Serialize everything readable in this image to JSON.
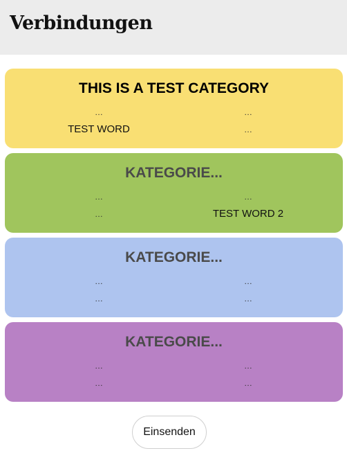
{
  "header": {
    "title": "Verbindungen"
  },
  "categories": [
    {
      "title": "THIS IS A TEST CATEGORY",
      "color": "#f9df73",
      "words": [
        [
          "…",
          "…"
        ],
        [
          "TEST WORD",
          "…"
        ]
      ]
    },
    {
      "title": "KATEGORIE...",
      "color": "#a0c55d",
      "words": [
        [
          "…",
          "…"
        ],
        [
          "…",
          "TEST WORD 2"
        ]
      ]
    },
    {
      "title": "KATEGORIE...",
      "color": "#aec4ef",
      "words": [
        [
          "…",
          "…"
        ],
        [
          "…",
          "…"
        ]
      ]
    },
    {
      "title": "KATEGORIE...",
      "color": "#b881c5",
      "words": [
        [
          "…",
          "…"
        ],
        [
          "…",
          "…"
        ]
      ]
    }
  ],
  "submit": {
    "label": "Einsenden"
  }
}
